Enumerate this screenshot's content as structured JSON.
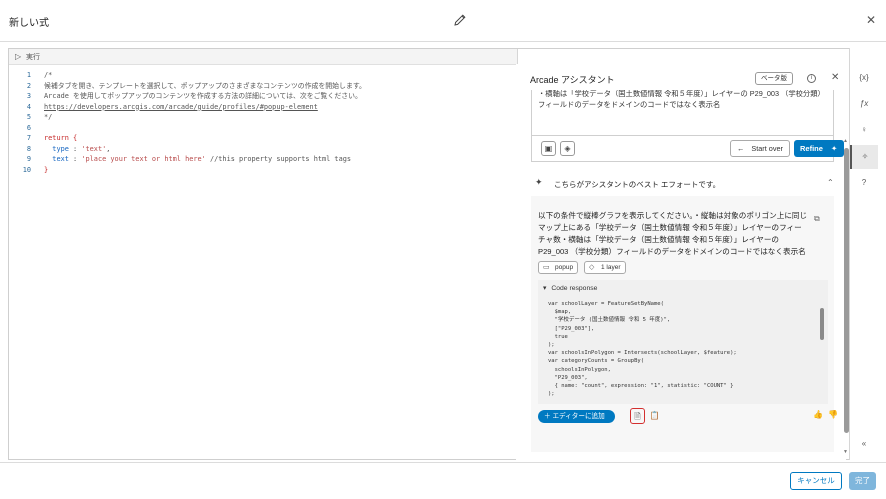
{
  "window": {
    "title": "新しい式"
  },
  "editor": {
    "run_label": "実行",
    "lines": [
      {
        "n": "1",
        "segments": [
          {
            "t": "/*",
            "c": "c-comment"
          }
        ]
      },
      {
        "n": "2",
        "segments": [
          {
            "t": "候補タブを開き、テンプレートを選択して、ポップアップのさまざまなコンテンツの作成を開始します。",
            "c": "c-comment"
          }
        ]
      },
      {
        "n": "3",
        "segments": [
          {
            "t": "Arcade を使用してポップアップのコンテンツを作成する方法の詳細については、次をご覧ください。",
            "c": "c-comment"
          }
        ]
      },
      {
        "n": "4",
        "segments": [
          {
            "t": "https://developers.arcgis.com/arcade/guide/profiles/#popup-element",
            "c": "c-link"
          }
        ]
      },
      {
        "n": "5",
        "segments": [
          {
            "t": "*/",
            "c": "c-comment"
          }
        ]
      },
      {
        "n": "6",
        "segments": []
      },
      {
        "n": "7",
        "segments": [
          {
            "t": "return {",
            "c": "c-kw"
          }
        ]
      },
      {
        "n": "8",
        "segments": [
          {
            "t": "  type",
            "c": "c-prop"
          },
          {
            "t": " : ",
            "c": ""
          },
          {
            "t": "'text'",
            "c": "c-str"
          },
          {
            "t": ",",
            "c": ""
          }
        ]
      },
      {
        "n": "9",
        "segments": [
          {
            "t": "  text",
            "c": "c-prop"
          },
          {
            "t": " : ",
            "c": ""
          },
          {
            "t": "'place your text or html here'",
            "c": "c-str"
          },
          {
            "t": " //this property supports html tags",
            "c": "c-comment"
          }
        ]
      },
      {
        "n": "10",
        "segments": [
          {
            "t": "}",
            "c": "c-kw"
          }
        ]
      }
    ]
  },
  "assistant": {
    "title": "Arcade アシスタント",
    "beta_label": "ベータ版",
    "prompt_text": "・横軸は「学校データ（国土数値情報 令和５年度）」レイヤーの P29_003 （学校分類）フィールドのデータをドメインのコードではなく表示名",
    "start_over_label": "Start over",
    "refine_label": "Refine",
    "best_effort_label": "こちらがアシスタントのベスト エフォートです。",
    "response_text": "以下の条件で縦棒グラフを表示してください。・縦軸は対象のポリゴン上に同じマップ上にある「学校データ（国土数値情報 令和５年度）」レイヤーのフィーチャ数・横軸は「学校データ（国土数値情報 令和５年度）」レイヤーの P29_003 （学校分類）フィールドのデータをドメインのコードではなく表示名",
    "chips": [
      "popup",
      "1 layer"
    ],
    "code_response_label": "Code response",
    "code_lines": [
      "var schoolLayer = FeatureSetByName(",
      "  $map,",
      "  \"学校データ (国土数値情報 令和 5 年度)\",",
      "  [\"P29_003\"],",
      "  true",
      ");",
      "var schoolsInPolygon = Intersects(schoolLayer, $feature);",
      "var categoryCounts = GroupBy(",
      "  schoolsInPolygon,",
      "  \"P29_003\",",
      "  { name: \"count\", expression: \"1\", statistic: \"COUNT\" }",
      ");"
    ],
    "add_to_editor_label": "エディターに追加"
  },
  "rail": {
    "items": [
      "{x}",
      "ƒx",
      "bulb-icon",
      "sparkle-icon",
      "help-icon"
    ],
    "collapse": "«"
  },
  "footer": {
    "cancel_label": "キャンセル",
    "done_label": "完了"
  }
}
